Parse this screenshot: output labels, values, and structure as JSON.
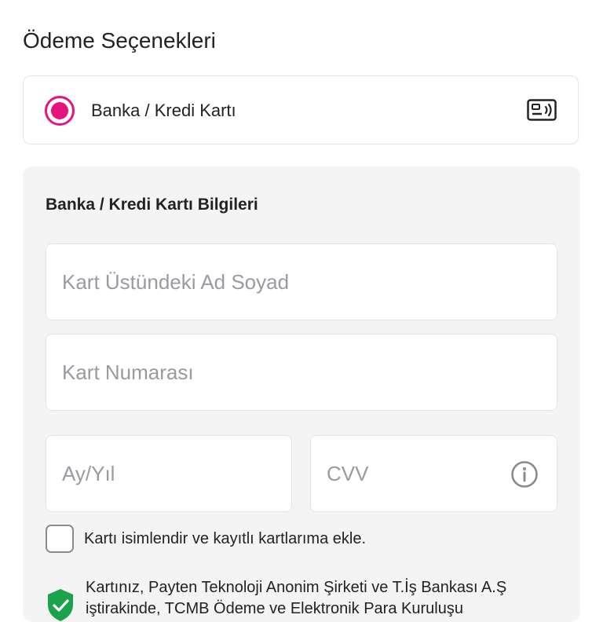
{
  "page": {
    "title": "Ödeme Seçenekleri"
  },
  "payment_method": {
    "label": "Banka / Kredi Kartı",
    "selected": true,
    "accent_color": "#e8127f",
    "icon": "card-contactless-icon"
  },
  "card_details": {
    "title": "Banka / Kredi Kartı Bilgileri",
    "name_field": {
      "value": "",
      "placeholder": "Kart Üstündeki Ad Soyad"
    },
    "number_field": {
      "value": "",
      "placeholder": "Kart Numarası"
    },
    "expiry_field": {
      "value": "",
      "placeholder": "Ay/Yıl"
    },
    "cvv_field": {
      "value": "",
      "placeholder": "CVV",
      "info_icon": "info-icon"
    },
    "save_card": {
      "label": "Kartı isimlendir ve kayıtlı kartlarıma ekle.",
      "checked": false
    },
    "security_notice": {
      "text": "Kartınız, Payten Teknoloji Anonim Şirketi ve T.İş Bankası A.Ş iştirakinde, TCMB Ödeme ve Elektronik Para Kuruluşu",
      "icon": "shield-check-icon",
      "icon_color": "#1aa34a"
    }
  }
}
